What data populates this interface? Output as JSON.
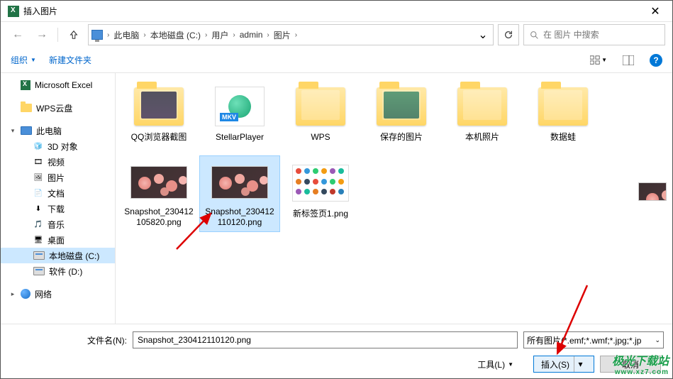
{
  "title": "插入图片",
  "nav": {
    "back": "←",
    "forward": "→"
  },
  "breadcrumb": [
    "此电脑",
    "本地磁盘 (C:)",
    "用户",
    "admin",
    "图片"
  ],
  "search_placeholder": "在 图片 中搜索",
  "toolbar": {
    "organize": "组织",
    "newfolder": "新建文件夹"
  },
  "sidebar": {
    "items": [
      {
        "label": "Microsoft Excel",
        "type": "excel",
        "indent": 0,
        "exp": ""
      },
      {
        "label": "WPS云盘",
        "type": "folder",
        "indent": 0,
        "exp": ""
      },
      {
        "label": "此电脑",
        "type": "pc",
        "indent": 0,
        "exp": "▾"
      },
      {
        "label": "3D 对象",
        "type": "lib",
        "icon": "🧊",
        "indent": 1
      },
      {
        "label": "视频",
        "type": "lib",
        "icon": "🎞",
        "indent": 1
      },
      {
        "label": "图片",
        "type": "lib",
        "icon": "🖼",
        "indent": 1
      },
      {
        "label": "文档",
        "type": "lib",
        "icon": "📄",
        "indent": 1
      },
      {
        "label": "下载",
        "type": "lib",
        "icon": "⬇",
        "indent": 1
      },
      {
        "label": "音乐",
        "type": "lib",
        "icon": "🎵",
        "indent": 1
      },
      {
        "label": "桌面",
        "type": "lib",
        "icon": "🖥",
        "indent": 1
      },
      {
        "label": "本地磁盘 (C:)",
        "type": "drive",
        "indent": 1,
        "sel": true
      },
      {
        "label": "软件 (D:)",
        "type": "drive",
        "indent": 1
      },
      {
        "label": "网络",
        "type": "net",
        "indent": 0,
        "exp": "▸"
      }
    ]
  },
  "files": [
    {
      "name": "QQ浏览器截图",
      "kind": "folder",
      "preview": "dark"
    },
    {
      "name": "StellarPlayer",
      "kind": "folder",
      "preview": "stellar"
    },
    {
      "name": "WPS",
      "kind": "folder"
    },
    {
      "name": "保存的图片",
      "kind": "folder",
      "preview": "green"
    },
    {
      "name": "本机照片",
      "kind": "folder"
    },
    {
      "name": "数据蛙",
      "kind": "folder"
    },
    {
      "name": "Snapshot_230412105820.png",
      "kind": "image"
    },
    {
      "name": "Snapshot_230412110120.png",
      "kind": "image",
      "selected": true
    },
    {
      "name": "新标签页1.png",
      "kind": "icons"
    }
  ],
  "footer": {
    "filename_label": "文件名(N):",
    "filename_value": "Snapshot_230412110120.png",
    "filetype": "所有图片(*.emf;*.wmf;*.jpg;*.jp",
    "tools": "工具(L)",
    "insert": "插入(S)",
    "cancel": "取消"
  },
  "watermark": {
    "brand": "极光下载站",
    "url": "www.xz7.com"
  }
}
